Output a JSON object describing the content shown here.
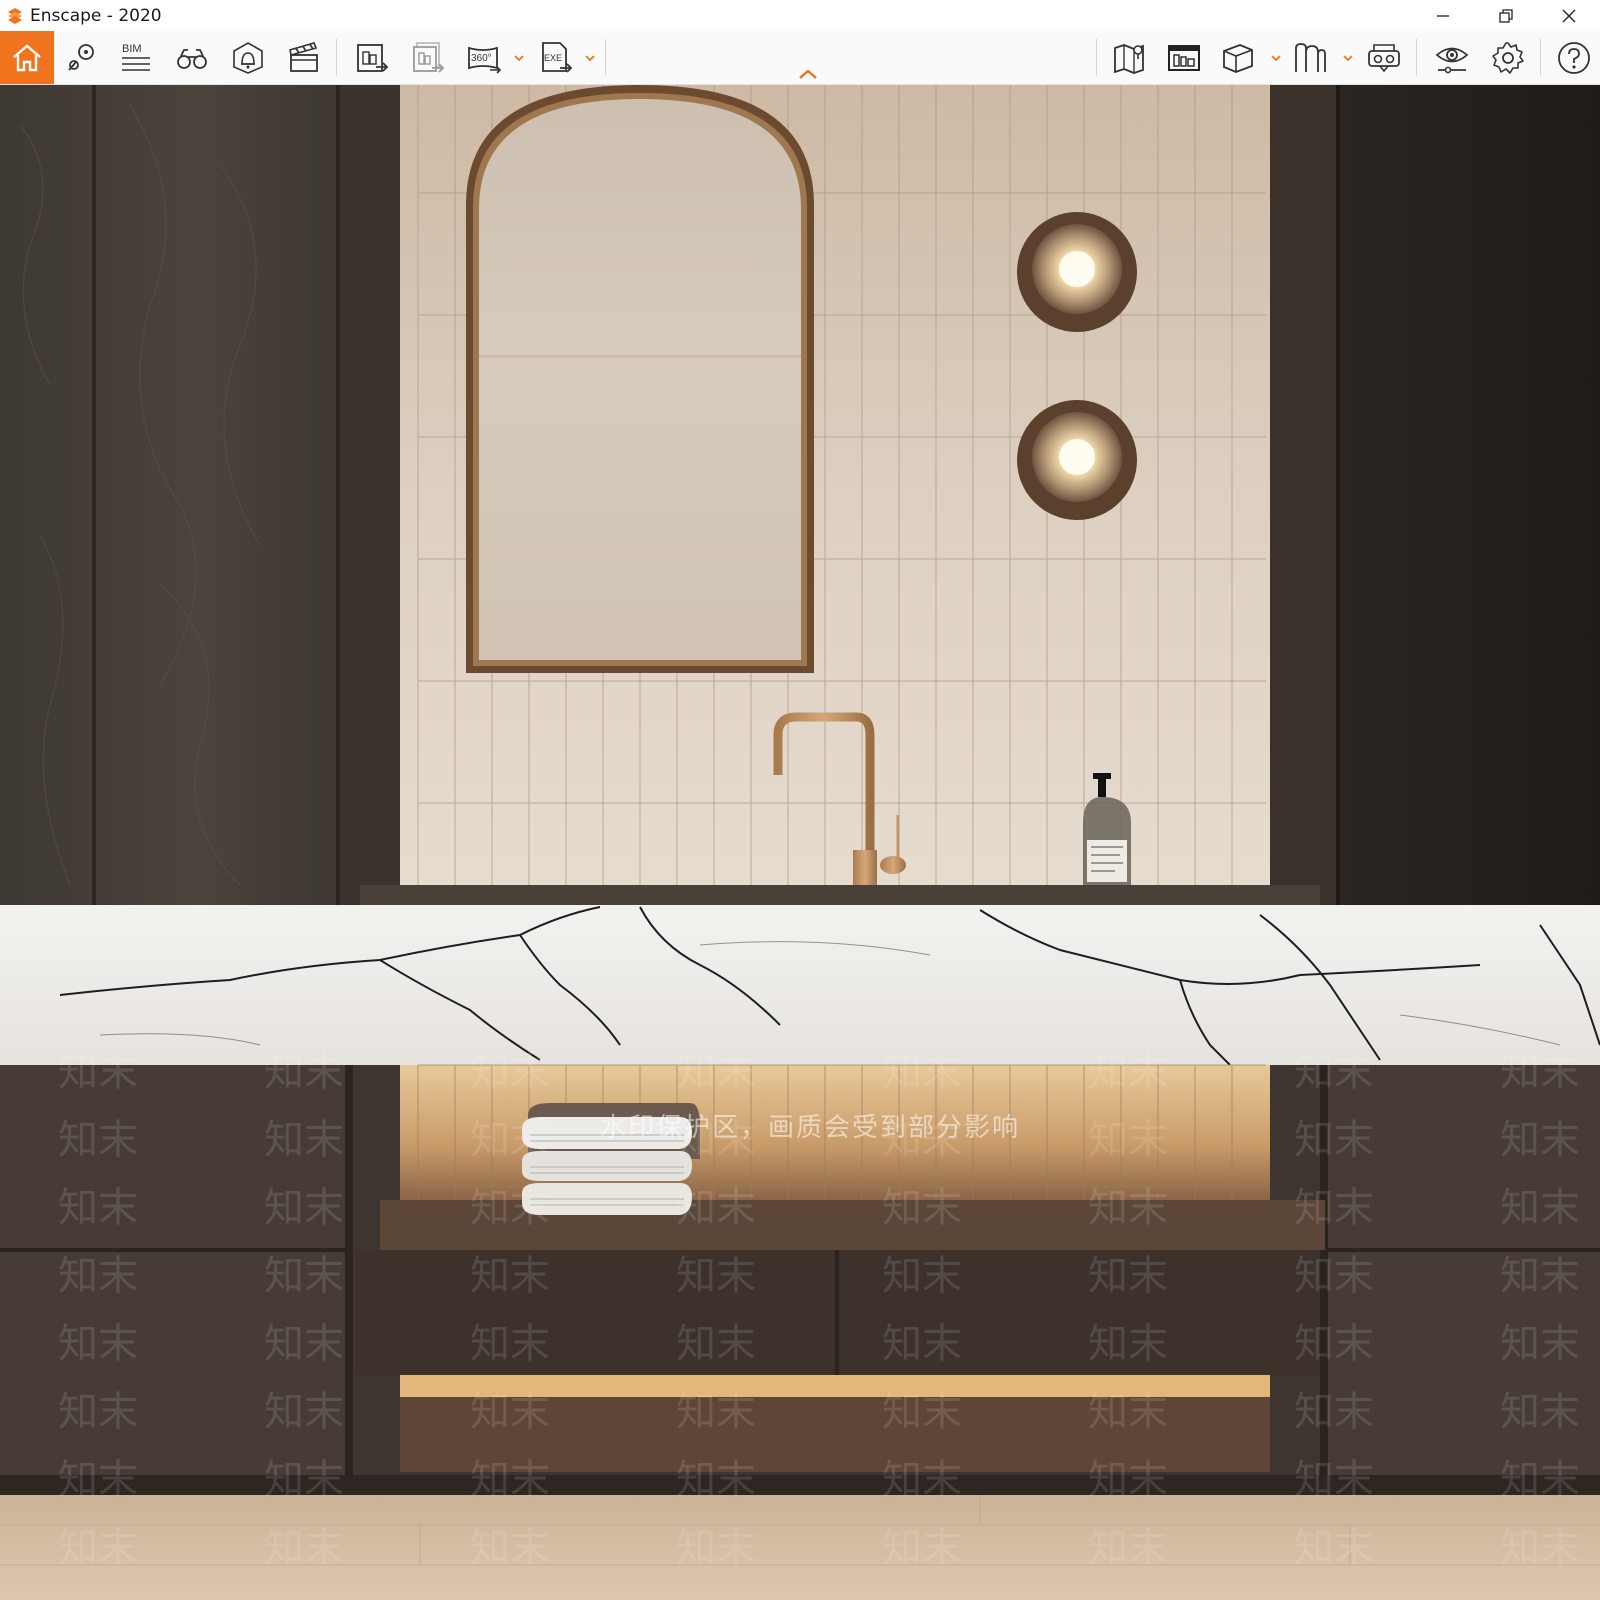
{
  "window": {
    "title": "Enscape - 2020",
    "controls": {
      "minimize": "minimize-icon",
      "restore": "restore-icon",
      "close": "close-icon"
    }
  },
  "toolbar": {
    "accent_color": "#f0731d",
    "left_tools": [
      {
        "name": "home-icon"
      },
      {
        "name": "location-pin-icon"
      },
      {
        "name": "bim-icon",
        "label": "BIM"
      },
      {
        "name": "binoculars-icon"
      },
      {
        "name": "warning-bell-icon"
      },
      {
        "name": "clapper-icon"
      },
      {
        "name": "render-image-icon"
      },
      {
        "name": "batch-render-icon"
      },
      {
        "name": "panorama-360-icon",
        "label": "360°"
      },
      {
        "name": "export-exe-icon",
        "label": "EXE"
      }
    ],
    "right_tools": [
      {
        "name": "map-icon"
      },
      {
        "name": "asset-library-icon"
      },
      {
        "name": "cube-view-icon"
      },
      {
        "name": "section-icon"
      },
      {
        "name": "vr-headset-icon"
      },
      {
        "name": "visual-settings-icon"
      },
      {
        "name": "gear-icon"
      },
      {
        "name": "help-icon"
      }
    ]
  },
  "viewport": {
    "watermark_banner": "水印保护区，画质会受到部分影响",
    "watermark_tile": "知末"
  }
}
